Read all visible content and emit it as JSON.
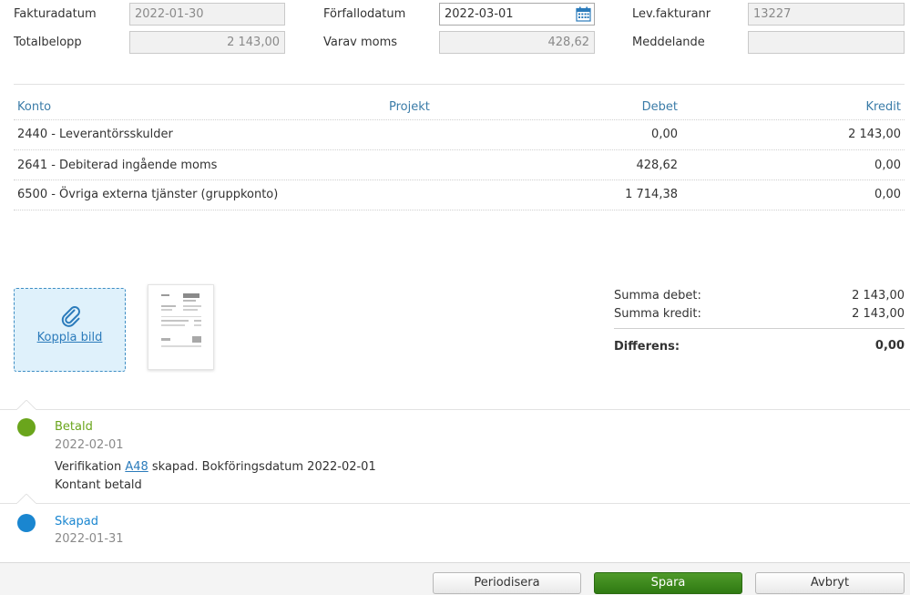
{
  "header": {
    "fakturadatum_label": "Fakturadatum",
    "fakturadatum_value": "2022-01-30",
    "forfallodatum_label": "Förfallodatum",
    "forfallodatum_value": "2022-03-01",
    "levfakturanr_label": "Lev.fakturanr",
    "levfakturanr_value": "13227",
    "totalbelopp_label": "Totalbelopp",
    "totalbelopp_value": "2 143,00",
    "varav_moms_label": "Varav moms",
    "varav_moms_value": "428,62",
    "meddelande_label": "Meddelande",
    "meddelande_value": ""
  },
  "table": {
    "columns": [
      "Konto",
      "Projekt",
      "Debet",
      "Kredit"
    ],
    "rows": [
      {
        "konto": "2440  -  Leverantörsskulder",
        "projekt": "",
        "debet": "0,00",
        "kredit": "2 143,00"
      },
      {
        "konto": "2641  -  Debiterad ingående moms",
        "projekt": "",
        "debet": "428,62",
        "kredit": "0,00"
      },
      {
        "konto": "6500  -  Övriga externa tjänster (gruppkonto)",
        "projekt": "",
        "debet": "1 714,38",
        "kredit": "0,00"
      }
    ]
  },
  "attachment": {
    "link_label": "Koppla bild",
    "icon": "paperclip-icon"
  },
  "summary": {
    "debet_label": "Summa debet:",
    "debet_value": "2 143,00",
    "kredit_label": "Summa kredit:",
    "kredit_value": "2 143,00",
    "diff_label": "Differens:",
    "diff_value": "0,00"
  },
  "timeline": [
    {
      "title": "Betald",
      "date": "2022-02-01",
      "line1_prefix": "Verifikation ",
      "line1_link": "A48",
      "line1_suffix": " skapad. Bokföringsdatum 2022-02-01",
      "line2": "Kontant betald",
      "color": "#6aa51c"
    },
    {
      "title": "Skapad",
      "date": "2022-01-31",
      "color": "#1a86d0"
    }
  ],
  "buttons": {
    "periodisera": "Periodisera",
    "spara": "Spara",
    "avbryt": "Avbryt"
  },
  "colors": {
    "accent_blue": "#3b7ca8",
    "paid_green": "#6aa51c",
    "created_blue": "#1a86d0",
    "save_green": "#3d8a1c"
  }
}
